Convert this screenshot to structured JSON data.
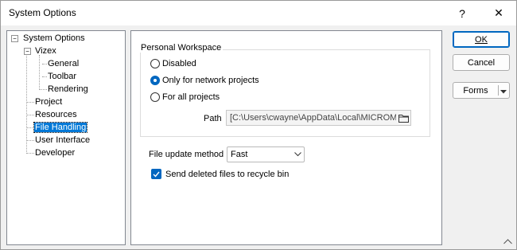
{
  "window": {
    "title": "System Options"
  },
  "titlebar": {
    "help": "?",
    "close": "✕"
  },
  "tree": {
    "root": "System Options",
    "vizex": "Vizex",
    "general": "General",
    "toolbar": "Toolbar",
    "rendering": "Rendering",
    "project": "Project",
    "resources": "Resources",
    "file_handling": "File Handling",
    "user_interface": "User Interface",
    "developer": "Developer",
    "selected": "File Handling"
  },
  "personal_workspace": {
    "caption": "Personal Workspace",
    "options": [
      "Disabled",
      "Only for network projects",
      "For all projects"
    ],
    "selected": "Only for network projects",
    "path_label": "Path",
    "path_value": "[C:\\Users\\cwayne\\AppData\\Local\\MICROM"
  },
  "file_update": {
    "label": "File update method",
    "value": "Fast"
  },
  "recycle": {
    "label": "Send deleted files to recycle bin",
    "checked": true
  },
  "buttons": {
    "ok": "OK",
    "cancel": "Cancel",
    "forms": "Forms"
  },
  "colors": {
    "accent": "#0067c0",
    "selection": "#0078d7"
  }
}
